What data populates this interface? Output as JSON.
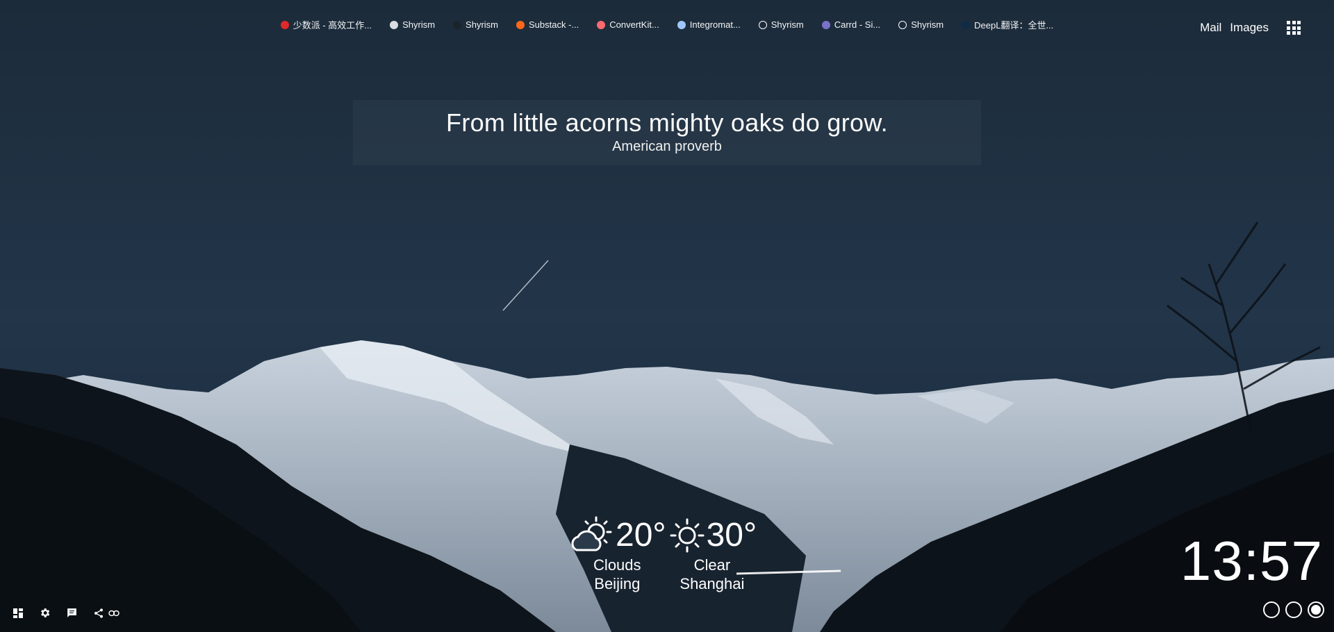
{
  "bookmarks": [
    {
      "label": "少数派 - 高效工作...",
      "icon": "sspai-icon",
      "color": "#e0292b"
    },
    {
      "label": "Shyrism",
      "icon": "shyrism-icon",
      "color": "#d9dde2"
    },
    {
      "label": "Shyrism",
      "icon": "shyrism-dark-icon",
      "color": "#1b232c"
    },
    {
      "label": "Substack -...",
      "icon": "substack-icon",
      "color": "#ff6719"
    },
    {
      "label": "ConvertKit...",
      "icon": "convertkit-icon",
      "color": "#fb6970"
    },
    {
      "label": "Integromat...",
      "icon": "integromat-icon",
      "color": "#9fc6ff"
    },
    {
      "label": "Shyrism",
      "icon": "shyrism-circle-icon",
      "color": "#ffffff"
    },
    {
      "label": "Carrd - Si...",
      "icon": "carrd-icon",
      "color": "#7a72c8"
    },
    {
      "label": "Shyrism",
      "icon": "shyrism-circle-icon",
      "color": "#ffffff"
    },
    {
      "label": "DeepL翻译：全世...",
      "icon": "deepl-icon",
      "color": "#0f2b46"
    }
  ],
  "topright": {
    "mail": "Mail",
    "images": "Images",
    "apps_icon": "apps-grid-icon"
  },
  "quote": {
    "text": "From little acorns mighty oaks do grow.",
    "author": "American proverb"
  },
  "weather": [
    {
      "temp": "20°",
      "condition": "Clouds",
      "city": "Beijing",
      "icon": "partly-cloudy-icon"
    },
    {
      "temp": "30°",
      "condition": "Clear",
      "city": "Shanghai",
      "icon": "sun-icon"
    }
  ],
  "clock": {
    "time": "13:57"
  },
  "toolbar": [
    "dashboard-icon",
    "settings-icon",
    "feedback-icon",
    "share-icon",
    "link-icon"
  ],
  "page_dots": {
    "count": 3,
    "active_index": 2
  }
}
